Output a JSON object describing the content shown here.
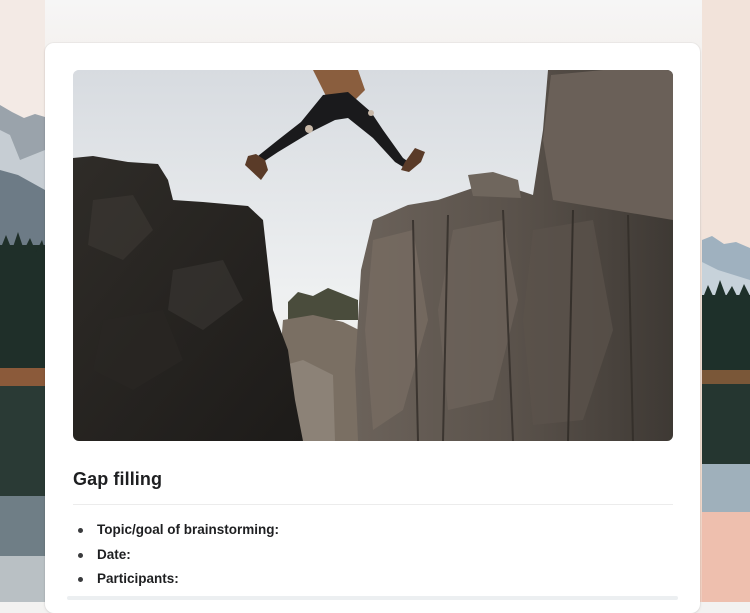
{
  "hero_image": {
    "alt_subject": "person-jumping-between-rocks"
  },
  "section": {
    "title": "Gap filling"
  },
  "bullets": [
    {
      "label": "Topic/goal of brainstorming:"
    },
    {
      "label": "Date:"
    },
    {
      "label": "Participants:"
    }
  ],
  "colors": {
    "card": "#ffffff",
    "text": "#1e1f21",
    "bullet": "#3a3b3d",
    "divider": "#ececec"
  }
}
